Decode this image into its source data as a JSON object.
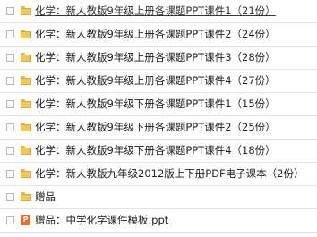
{
  "files": [
    {
      "label": "化学：新人教版9年级上册各课题PPT课件1（21份）",
      "icon": "folder-icon"
    },
    {
      "label": "化学：新人教版9年级上册各课题PPT课件2（24份）",
      "icon": "folder-icon"
    },
    {
      "label": "化学：新人教版9年级上册各课题PPT课件3（28份）",
      "icon": "folder-icon"
    },
    {
      "label": "化学：新人教版9年级上册各课题PPT课件4（27份）",
      "icon": "folder-icon"
    },
    {
      "label": "化学：新人教版9年级下册各课题PPT课件1（15份）",
      "icon": "folder-icon"
    },
    {
      "label": "化学：新人教版9年级下册各课题PPT课件2（25份）",
      "icon": "folder-icon"
    },
    {
      "label": "化学：新人教版9年级下册各课题PPT课件4（18份）",
      "icon": "folder-icon"
    },
    {
      "label": "化学：新人教版九年级2012版上下册PDF电子课本（2份）",
      "icon": "folder-icon"
    },
    {
      "label": "赠品",
      "icon": "folder-icon"
    },
    {
      "label": "赠品：中学化学课件模板.ppt",
      "icon": "ppt-file-icon"
    }
  ],
  "colors": {
    "folder": "#f2c75c",
    "ppt": "#e86b2c",
    "row_divider": "#e6e6e6"
  }
}
